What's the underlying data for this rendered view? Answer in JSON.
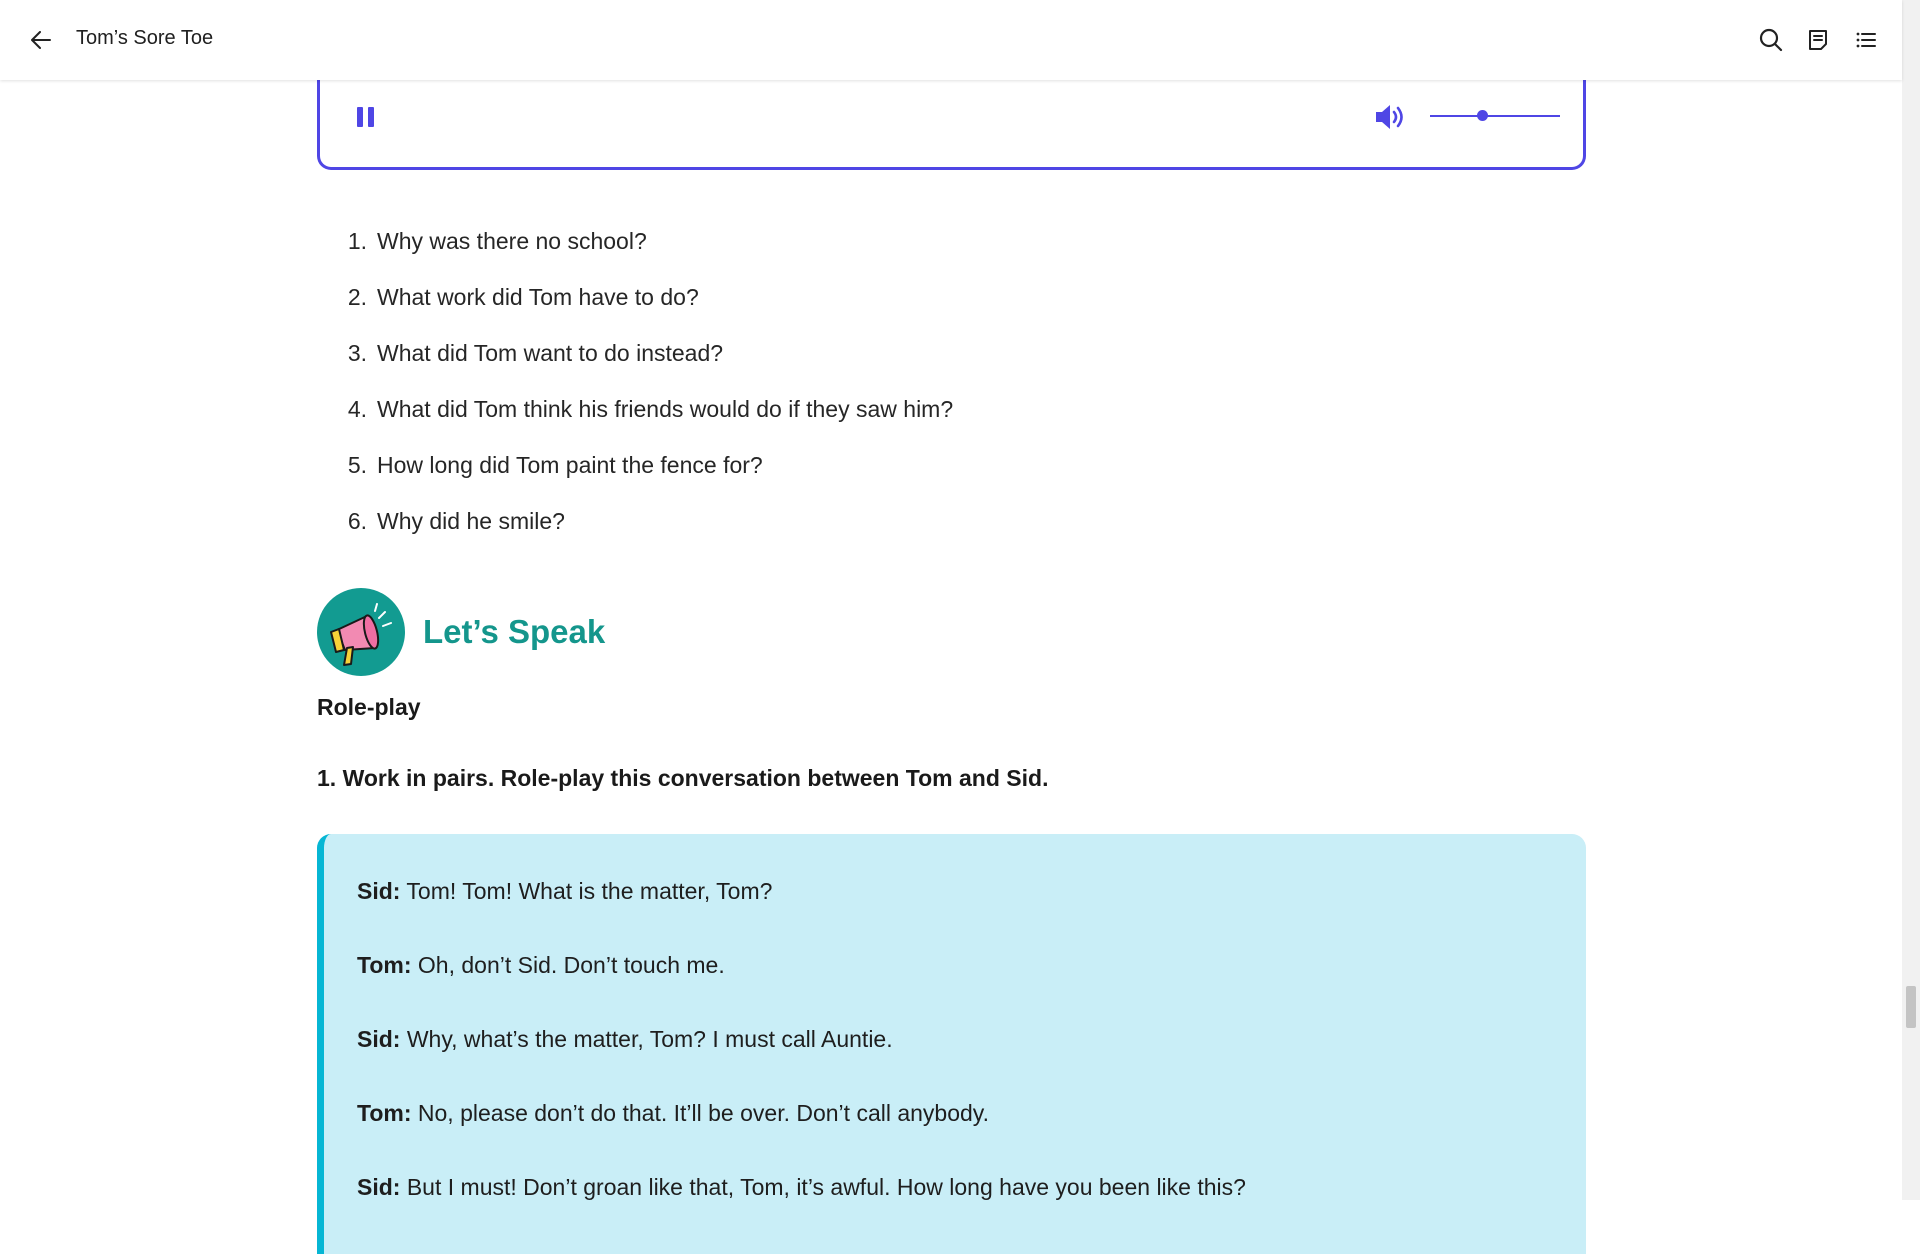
{
  "header": {
    "title": "Tom’s Sore Toe"
  },
  "audio": {
    "state": "playing",
    "volume_fraction": 0.4,
    "accent_color": "#4f46e5"
  },
  "questions": [
    {
      "num": "1.",
      "text": "Why was there no school?"
    },
    {
      "num": "2.",
      "text": "What work did Tom have to do?"
    },
    {
      "num": "3.",
      "text": "What did Tom want to do instead?"
    },
    {
      "num": "4.",
      "text": "What did Tom think his friends would do if they saw him?"
    },
    {
      "num": "5.",
      "text": "How long did Tom paint the fence for?"
    },
    {
      "num": "6.",
      "text": "Why did he smile?"
    }
  ],
  "speak_section": {
    "title": "Let’s Speak",
    "icon": "megaphone-icon",
    "color": "#14968c"
  },
  "roleplay": {
    "title": "Role-play",
    "instruction": "1. Work in pairs. Role-play this conversation between Tom and Sid."
  },
  "dialogue": [
    {
      "speaker": "Sid:",
      "text": " Tom! Tom! What is the matter, Tom?"
    },
    {
      "speaker": "Tom:",
      "text": " Oh, don’t Sid. Don’t touch me."
    },
    {
      "speaker": "Sid:",
      "text": " Why, what’s the matter, Tom? I must call Auntie."
    },
    {
      "speaker": "Tom:",
      "text": " No, please don’t do that. It’ll be over. Don’t call anybody."
    },
    {
      "speaker": "Sid:",
      "text": " But I must! Don’t groan like that, Tom, it’s awful. How long have you been like this?"
    }
  ]
}
